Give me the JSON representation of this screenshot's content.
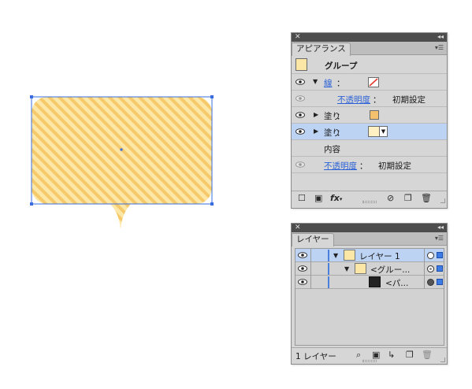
{
  "colors": {
    "artwork_fill": "#fde7a6",
    "artwork_stripe": "#f6c96a",
    "selection": "#3a6ee0",
    "swatch_fill_1": "#f5c16e",
    "swatch_fill_2": "#fff1c4",
    "stroke_red": "#e23a2e",
    "row_selected": "#bcd3f4",
    "link": "#2c62d6"
  },
  "appearance_panel": {
    "tab_title": "アピアランス",
    "header_label": "グループ",
    "rows": [
      {
        "kind": "stroke",
        "label": "線",
        "colon": "：",
        "visible": true,
        "expanded": true,
        "icon": "stroke-none-swatch-icon"
      },
      {
        "kind": "opacity",
        "label": "不透明度",
        "colon": "：",
        "value": "初期設定",
        "visible": false,
        "indented": true
      },
      {
        "kind": "fill",
        "label": "塗り",
        "colon": "：",
        "visible": true,
        "expanded": false,
        "icon": "fill-swatch-orange"
      },
      {
        "kind": "fill",
        "label": "塗り",
        "colon": "：",
        "visible": true,
        "expanded": false,
        "selected": true,
        "icon": "fill-swatch-cream"
      },
      {
        "kind": "contents",
        "label": "内容"
      },
      {
        "kind": "opacity",
        "label": "不透明度",
        "colon": "：",
        "value": "初期設定",
        "visible": false
      }
    ],
    "bottom_icons": [
      "square-icon",
      "square-filled-icon",
      "fx-icon",
      "clear-icon",
      "duplicate-icon",
      "trash-icon"
    ],
    "fx_label": "fx"
  },
  "layers_panel": {
    "tab_title": "レイヤー",
    "layers": [
      {
        "name": "レイヤー 1",
        "level": 0,
        "expanded": true,
        "selected": true
      },
      {
        "name": "<グルー...",
        "level": 1,
        "expanded": true,
        "selected": false
      },
      {
        "name": "<パ...",
        "level": 2,
        "expanded": false,
        "selected": false
      }
    ],
    "footer_label": "1 レイヤー",
    "bottom_icons": [
      "search-icon",
      "clipping-mask-icon",
      "new-sublayer-icon",
      "new-layer-icon",
      "trash-icon"
    ]
  }
}
